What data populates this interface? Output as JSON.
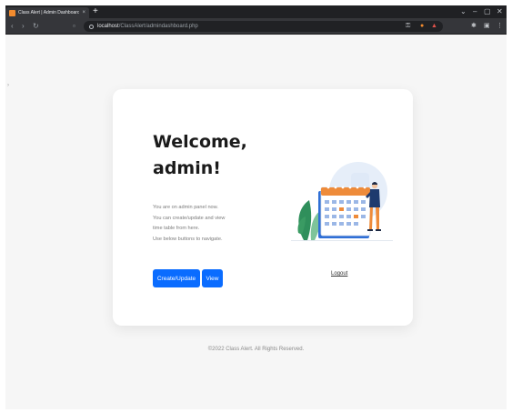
{
  "browser": {
    "tab_title": "Class Alert | Admin Dashboard",
    "tab_close": "×",
    "new_tab": "+",
    "win_minimize": "–",
    "win_maximize": "▢",
    "win_close": "✕",
    "url_host": "localhost",
    "url_path": "/ClassAlert/admindashboard.php",
    "colors": {
      "tab_bar": "#202124",
      "toolbar": "#35363a"
    }
  },
  "card": {
    "welcome_line1": "Welcome,",
    "welcome_line2": "admin!",
    "desc_line1": "You are on admin panel now.",
    "desc_line2": "You can create/update and view",
    "desc_line3": "time table from here.",
    "desc_line4": "Use below buttons to navigate.",
    "create_button": "Create/Update",
    "view_button": "View",
    "logout_link": "Logout",
    "colors": {
      "primary": "#0a6cff",
      "card_bg": "#ffffff",
      "page_bg": "#f6f6f6"
    }
  },
  "footer": {
    "text": "©2022 Class Alert. All Rights Reserved."
  }
}
